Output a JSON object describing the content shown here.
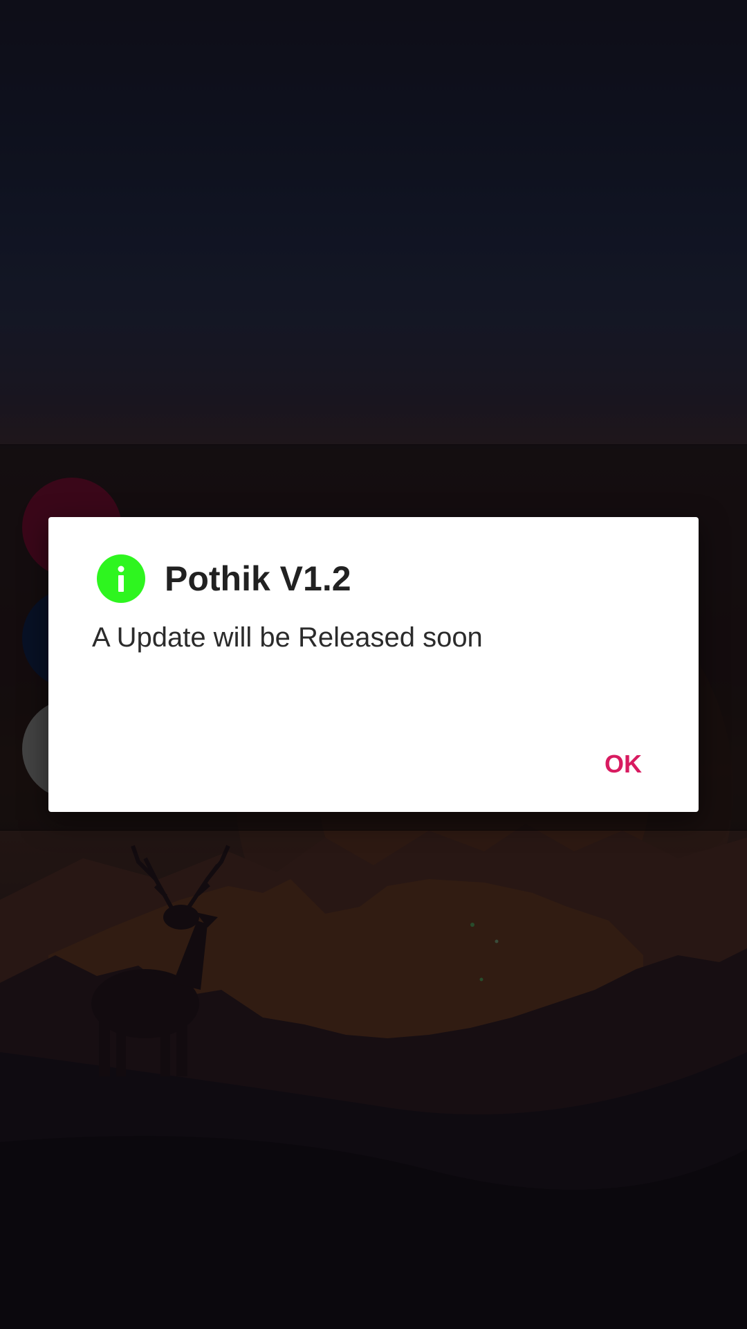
{
  "background": {
    "menu_items": [
      {
        "label": "",
        "color": "#6b0d2e"
      },
      {
        "label": "",
        "color": "#0f1f44"
      },
      {
        "label": "",
        "color": "#7a7a7a"
      }
    ]
  },
  "dialog": {
    "icon": "info-icon",
    "icon_color": "#2ef51f",
    "title": "Pothik V1.2",
    "message": "A Update will be Released soon",
    "ok_label": "OK",
    "accent_color": "#d81b60"
  }
}
